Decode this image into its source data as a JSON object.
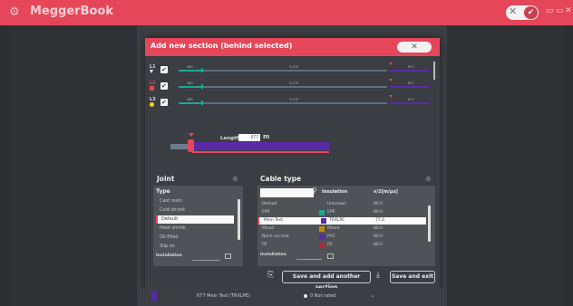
{
  "app": {
    "title": "MeggerBook",
    "icon": "gear-icon"
  },
  "titlebar": {
    "cancel_glyph": "✕",
    "confirm_glyph": "✔",
    "window_controls": [
      "▭",
      "▭",
      "✕"
    ]
  },
  "dialog": {
    "title": "Add new section (behind selected)",
    "close_glyph": "✕",
    "phases": [
      {
        "label": "L1",
        "start": "460",
        "mid": "3,270",
        "end": "677",
        "marker_color": "#ffffff"
      },
      {
        "label": "L2",
        "start": "460",
        "mid": "3,270",
        "end": "677",
        "marker_color": "#e5465a"
      },
      {
        "label": "L3",
        "start": "460",
        "mid": "3,270",
        "end": "677",
        "marker_color": "#f5d327"
      }
    ],
    "length": {
      "label": "Length",
      "value": "677",
      "unit": "m",
      "fill_fraction": 1.0
    },
    "joint": {
      "title": "Joint",
      "type_header": "Type",
      "items": [
        "Cast resin",
        "Cold shrink",
        "Default",
        "Heat shrink",
        "Oil filled",
        "Slip on"
      ],
      "selected": "Default",
      "installation_label": "Installation"
    },
    "cable": {
      "title": "Cable type",
      "col_insulation": "Insulation",
      "col_value": "v/2[m/µs]",
      "rows": [
        {
          "name": "Default",
          "insulation": "Unknown",
          "value": "80.0",
          "color": "#4f5256"
        },
        {
          "name": "EPR",
          "insulation": "EPR",
          "value": "80.0",
          "color": "#1aa897"
        },
        {
          "name": "Mein Test",
          "insulation": "TRXLPE",
          "value": "77.0",
          "color": "#5a2aa6"
        },
        {
          "name": "Mixed",
          "insulation": "Mixed",
          "value": "80.0",
          "color": "#c68a00"
        },
        {
          "name": "Noch ein test",
          "insulation": "PVC",
          "value": "80.0",
          "color": "#5a2aa6"
        },
        {
          "name": "PE",
          "insulation": "PE",
          "value": "80.0",
          "color": "#b3263b"
        }
      ],
      "selected": "Mein Test",
      "installation_label": "Installation"
    },
    "buttons": {
      "save_another": "Save and add another section",
      "save_exit": "Save and exit"
    }
  },
  "bottom": {
    "length_text": "677  Mein Test (TRXLPE)",
    "rated_text": "0  Not rated"
  }
}
